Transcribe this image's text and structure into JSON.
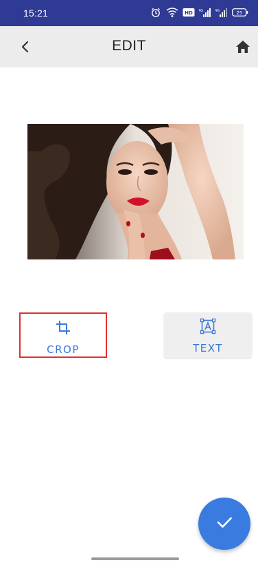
{
  "status_bar": {
    "time": "15:21",
    "battery": "25",
    "icons": [
      "alarm-icon",
      "wifi-icon",
      "hd-icon",
      "signal-icon",
      "signal-icon",
      "battery-icon"
    ]
  },
  "app_bar": {
    "title": "EDIT",
    "back_icon": "back-chevron-icon",
    "home_icon": "home-icon"
  },
  "photo": {
    "subject": "portrait-photo"
  },
  "actions": {
    "crop": {
      "label": "CROP",
      "icon": "crop-icon"
    },
    "text": {
      "label": "TEXT",
      "icon": "text-box-icon"
    }
  },
  "fab": {
    "icon": "check-icon"
  },
  "colors": {
    "status_bar": "#2f3a94",
    "app_bar": "#ececec",
    "accent": "#3a79d8",
    "fab": "#3a7be0",
    "highlight": "#e23030"
  }
}
